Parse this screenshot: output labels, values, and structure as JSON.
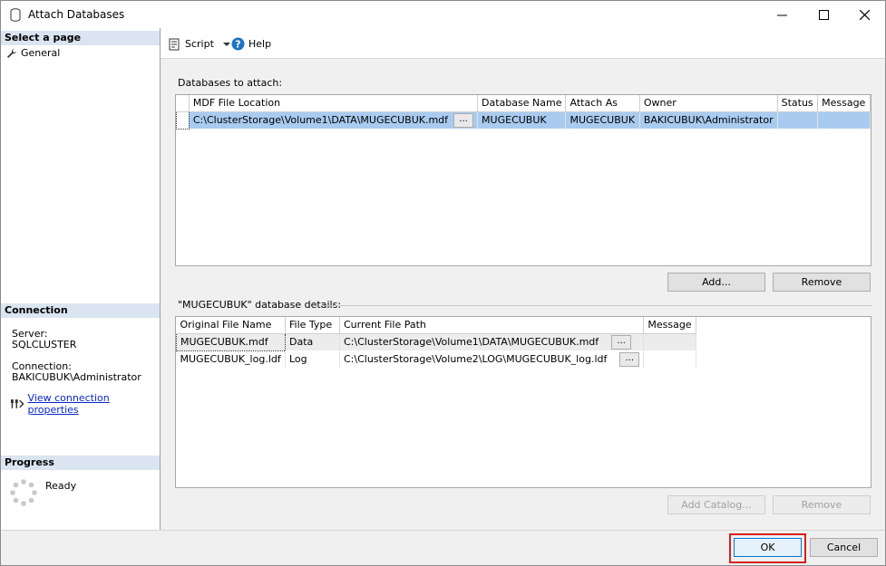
{
  "window": {
    "title": "Attach Databases"
  },
  "left": {
    "select_page_header": "Select a page",
    "nav_general": "General",
    "connection_header": "Connection",
    "server_label": "Server:",
    "server_value": "SQLCLUSTER",
    "connection_label": "Connection:",
    "connection_value": "BAKICUBUK\\Administrator",
    "view_props_link": "View connection properties",
    "progress_header": "Progress",
    "progress_status": "Ready"
  },
  "toolbar": {
    "script_label": "Script",
    "help_label": "Help"
  },
  "attach": {
    "group_label": "Databases to attach:",
    "columns": [
      "MDF File Location",
      "Database Name",
      "Attach As",
      "Owner",
      "Status",
      "Message"
    ],
    "rows": [
      {
        "mdf": "C:\\ClusterStorage\\Volume1\\DATA\\MUGECUBUK.mdf",
        "ellipsis": "...",
        "db_name": "MUGECUBUK",
        "attach_as": "MUGECUBUK",
        "owner": "BAKICUBUK\\Administrator",
        "status": "",
        "message": ""
      }
    ],
    "add_button": "Add...",
    "remove_button": "Remove"
  },
  "details": {
    "group_label": "\"MUGECUBUK\" database details:",
    "columns": [
      "Original File Name",
      "File Type",
      "Current File Path",
      "Message"
    ],
    "rows": [
      {
        "file": "MUGECUBUK.mdf",
        "type": "Data",
        "path": "C:\\ClusterStorage\\Volume1\\DATA\\MUGECUBUK.mdf",
        "ellipsis": "...",
        "message": ""
      },
      {
        "file": "MUGECUBUK_log.ldf",
        "type": "Log",
        "path": "C:\\ClusterStorage\\Volume2\\LOG\\MUGECUBUK_log.ldf",
        "ellipsis": "...",
        "message": ""
      }
    ],
    "add_catalog_button": "Add Catalog...",
    "remove_button": "Remove"
  },
  "footer": {
    "ok_button": "OK",
    "cancel_button": "Cancel"
  }
}
